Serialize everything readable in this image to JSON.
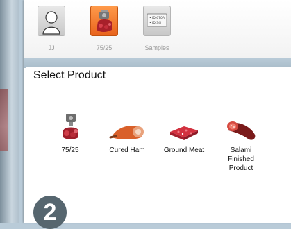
{
  "topbar": {
    "tabs": [
      {
        "label": "JJ",
        "icon": "user-icon"
      },
      {
        "label": "75/25",
        "icon": "grinder-icon",
        "active": true
      },
      {
        "label": "Samples",
        "icon": "samples-icon",
        "screen_text": "• ID 670A\n• ID 34i"
      }
    ]
  },
  "main": {
    "title": "Select Product",
    "products": [
      {
        "label": "75/25",
        "icon": "meat-grinder-icon"
      },
      {
        "label": "Cured Ham",
        "icon": "ham-icon"
      },
      {
        "label": "Ground Meat",
        "icon": "ground-meat-icon"
      },
      {
        "label": "Salami Finished Product",
        "icon": "salami-icon"
      }
    ],
    "step_number": "2"
  },
  "colors": {
    "active_tab": "#e8631c",
    "step_badge": "#56666f",
    "background": "#b9cbd8"
  }
}
